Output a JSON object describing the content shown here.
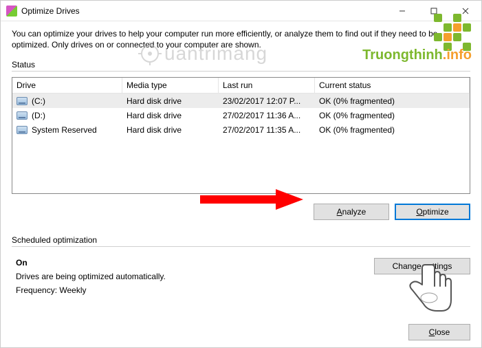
{
  "window": {
    "title": "Optimize Drives",
    "description": "You can optimize your drives to help your computer run more efficiently, or analyze them to find out if they need to be optimized. Only drives on or connected to your computer are shown."
  },
  "status": {
    "label": "Status",
    "columns": {
      "drive": "Drive",
      "media": "Media type",
      "last": "Last run",
      "status": "Current status"
    },
    "rows": [
      {
        "drive": "(C:)",
        "media": "Hard disk drive",
        "last": "23/02/2017 12:07 P...",
        "status": "OK (0% fragmented)",
        "selected": true
      },
      {
        "drive": "(D:)",
        "media": "Hard disk drive",
        "last": "27/02/2017 11:36 A...",
        "status": "OK (0% fragmented)",
        "selected": false
      },
      {
        "drive": "System Reserved",
        "media": "Hard disk drive",
        "last": "27/02/2017 11:35 A...",
        "status": "OK (0% fragmented)",
        "selected": false
      }
    ],
    "buttons": {
      "analyze": "Analyze",
      "optimize": "Optimize"
    }
  },
  "schedule": {
    "label": "Scheduled optimization",
    "on": "On",
    "line1": "Drives are being optimized automatically.",
    "freq_label": "Frequency:",
    "freq_value": "Weekly",
    "change": "Change settings"
  },
  "footer": {
    "close": "Close"
  },
  "watermarks": {
    "logo_text_a": "Truongthinh",
    "logo_text_b": ".info",
    "qtm": "uantrimang"
  }
}
